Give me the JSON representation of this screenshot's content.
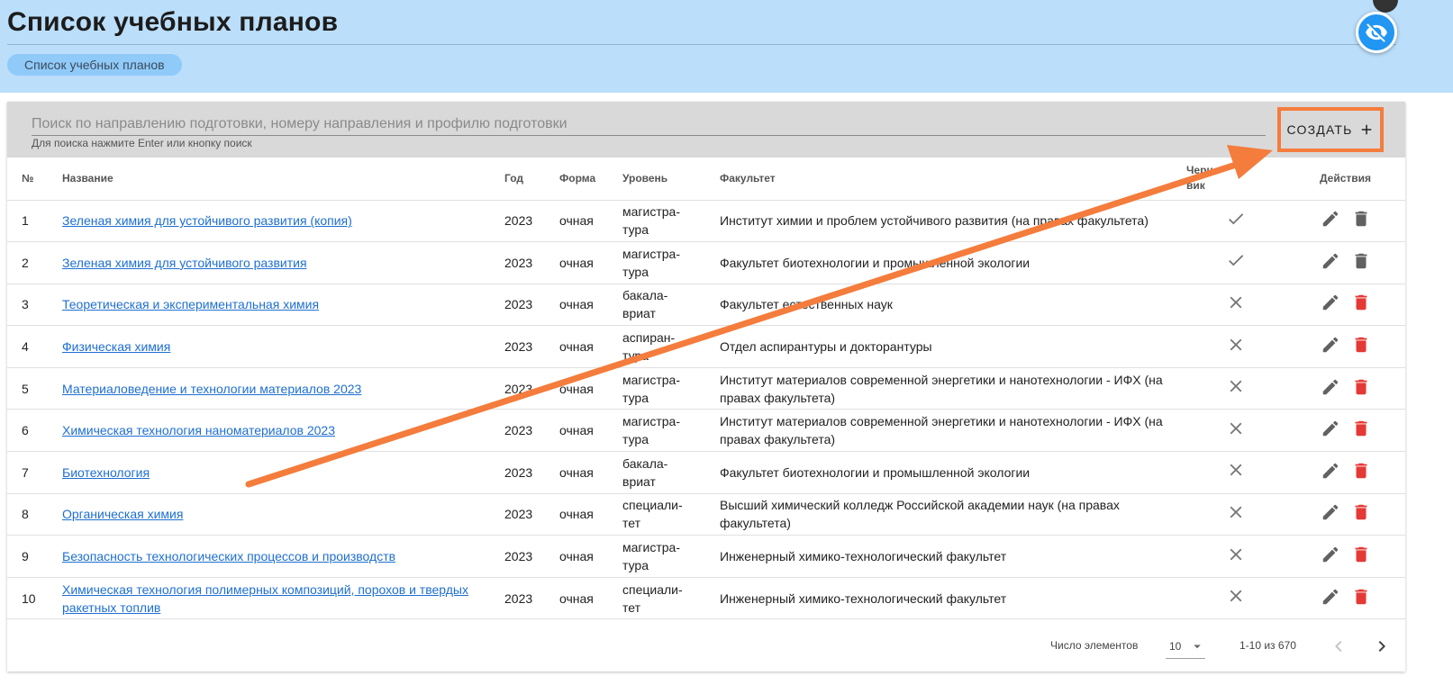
{
  "header": {
    "title": "Список учебных планов",
    "breadcrumb": "Список учебных планов"
  },
  "search": {
    "placeholder": "Поиск по направлению подготовки, номеру направления и профилю подготовки",
    "hint": "Для поиска нажмите Enter или кнопку поиск"
  },
  "toolbar": {
    "create_label": "СОЗДАТЬ"
  },
  "table": {
    "headers": {
      "num": "№",
      "name": "Название",
      "year": "Год",
      "form": "Форма",
      "level": "Уровень",
      "faculty": "Факультет",
      "draft_line1": "Черно-",
      "draft_line2": "вик",
      "actions": "Действия"
    },
    "rows": [
      {
        "num": "1",
        "name": "Зеленая химия для устойчивого развития (копия)",
        "year": "2023",
        "form": "очная",
        "level1": "магистра-",
        "level2": "тура",
        "faculty": "Институт химии и проблем устойчивого развития (на правах факультета)",
        "draft": "check",
        "delete_color": "#616161"
      },
      {
        "num": "2",
        "name": "Зеленая химия для устойчивого развития",
        "year": "2023",
        "form": "очная",
        "level1": "магистра-",
        "level2": "тура",
        "faculty": "Факультет биотехнологии и промышленной экологии",
        "draft": "check",
        "delete_color": "#616161"
      },
      {
        "num": "3",
        "name": "Теоретическая и экспериментальная химия",
        "year": "2023",
        "form": "очная",
        "level1": "бакала-",
        "level2": "вриат",
        "faculty": "Факультет естественных наук",
        "draft": "close",
        "delete_color": "#e53935"
      },
      {
        "num": "4",
        "name": "Физическая химия",
        "year": "2023",
        "form": "очная",
        "level1": "аспиран-",
        "level2": "тура",
        "faculty": "Отдел аспирантуры и докторантуры",
        "draft": "close",
        "delete_color": "#e53935"
      },
      {
        "num": "5",
        "name": "Материаловедение и технологии материалов 2023",
        "year": "2023",
        "form": "очная",
        "level1": "магистра-",
        "level2": "тура",
        "faculty": "Институт материалов современной энергетики и нанотехнологии - ИФХ (на правах факультета)",
        "draft": "close",
        "delete_color": "#e53935"
      },
      {
        "num": "6",
        "name": "Химическая технология наноматериалов 2023",
        "year": "2023",
        "form": "очная",
        "level1": "магистра-",
        "level2": "тура",
        "faculty": "Институт материалов современной энергетики и нанотехнологии - ИФХ (на правах факультета)",
        "draft": "close",
        "delete_color": "#e53935"
      },
      {
        "num": "7",
        "name": "Биотехнология",
        "year": "2023",
        "form": "очная",
        "level1": "бакала-",
        "level2": "вриат",
        "faculty": "Факультет биотехнологии и промышленной экологии",
        "draft": "close",
        "delete_color": "#e53935"
      },
      {
        "num": "8",
        "name": "Органическая химия",
        "year": "2023",
        "form": "очная",
        "level1": "специали-",
        "level2": "тет",
        "faculty": "Высший химический колледж Российской академии наук (на правах факультета)",
        "draft": "close",
        "delete_color": "#e53935"
      },
      {
        "num": "9",
        "name": "Безопасность технологических процессов и производств",
        "year": "2023",
        "form": "очная",
        "level1": "магистра-",
        "level2": "тура",
        "faculty": "Инженерный химико-технологический факультет",
        "draft": "close",
        "delete_color": "#e53935"
      },
      {
        "num": "10",
        "name": "Химическая технология полимерных композиций, порохов и твердых ракетных топлив",
        "year": "2023",
        "form": "очная",
        "level1": "специали-",
        "level2": "тет",
        "faculty": "Инженерный химико-технологический факультет",
        "draft": "close",
        "delete_color": "#e53935"
      }
    ]
  },
  "pagination": {
    "per_page_label": "Число элементов",
    "per_page_value": "10",
    "range": "1-10 из 670"
  },
  "colors": {
    "header_bg": "#bbdefb",
    "accent": "#2196f3",
    "annotation": "#f47c3c",
    "link": "#1e6fd1",
    "delete_active": "#e53935"
  },
  "icons": {
    "visibility": "visibility-off-icon",
    "create": "plus-icon",
    "edit": "pencil-icon",
    "delete": "trash-icon",
    "draft_yes": "check-icon",
    "draft_no": "close-icon",
    "prev": "chevron-left-icon",
    "next": "chevron-right-icon"
  }
}
